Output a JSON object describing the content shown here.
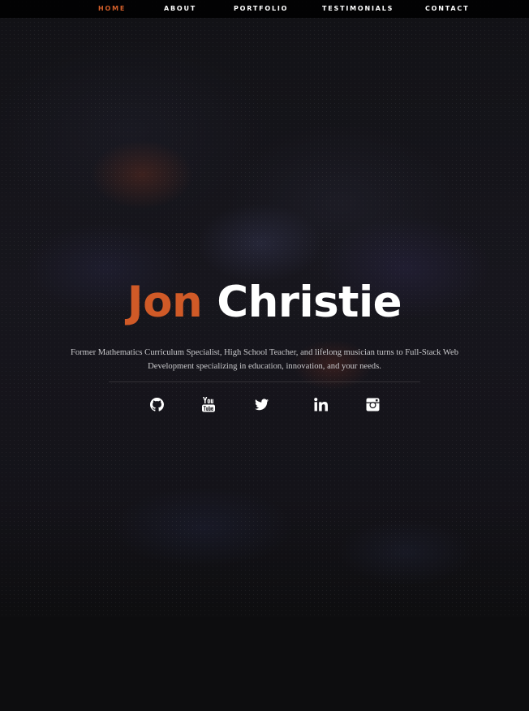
{
  "nav": {
    "items": [
      {
        "label": "HOME",
        "active": true
      },
      {
        "label": "ABOUT",
        "active": false
      },
      {
        "label": "PORTFOLIO",
        "active": false
      },
      {
        "label": "TESTIMONIALS",
        "active": false
      },
      {
        "label": "CONTACT",
        "active": false
      }
    ]
  },
  "hero": {
    "first_name": "Jon",
    "last_name": "Christie",
    "tagline": "Former Mathematics Curriculum Specialist, High School Teacher, and lifelong musician turns to Full-Stack Web Development specializing in education, innovation, and your needs."
  },
  "social": [
    {
      "icon": "github-icon"
    },
    {
      "icon": "youtube-icon"
    },
    {
      "icon": "twitter-icon"
    },
    {
      "icon": "linkedin-icon"
    },
    {
      "icon": "instagram-icon"
    }
  ],
  "colors": {
    "accent": "#d05a27",
    "nav_active": "#d35f2a",
    "text": "#ffffff",
    "background": "#0d0d0f"
  }
}
